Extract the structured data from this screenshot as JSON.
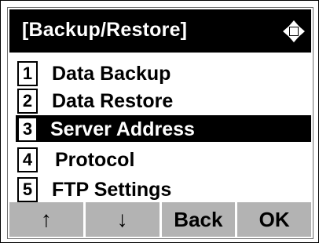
{
  "header": {
    "title": "[Backup/Restore]",
    "nav_icon": "four-way-navigation-icon"
  },
  "menu": {
    "items": [
      {
        "number": "1",
        "label": "Data Backup"
      },
      {
        "number": "2",
        "label": "Data Restore"
      },
      {
        "number": "3",
        "label": "Server Address",
        "selected": true
      },
      {
        "number": "4",
        "label": "Protocol"
      },
      {
        "number": "5",
        "label": "FTP Settings"
      }
    ]
  },
  "softkeys": {
    "up": "↑",
    "down": "↓",
    "back": "Back",
    "ok": "OK"
  },
  "colors": {
    "title_bg": "#000000",
    "title_fg": "#ffffff",
    "selected_bg": "#000000",
    "softkey_bg": "#b3b3b3"
  }
}
